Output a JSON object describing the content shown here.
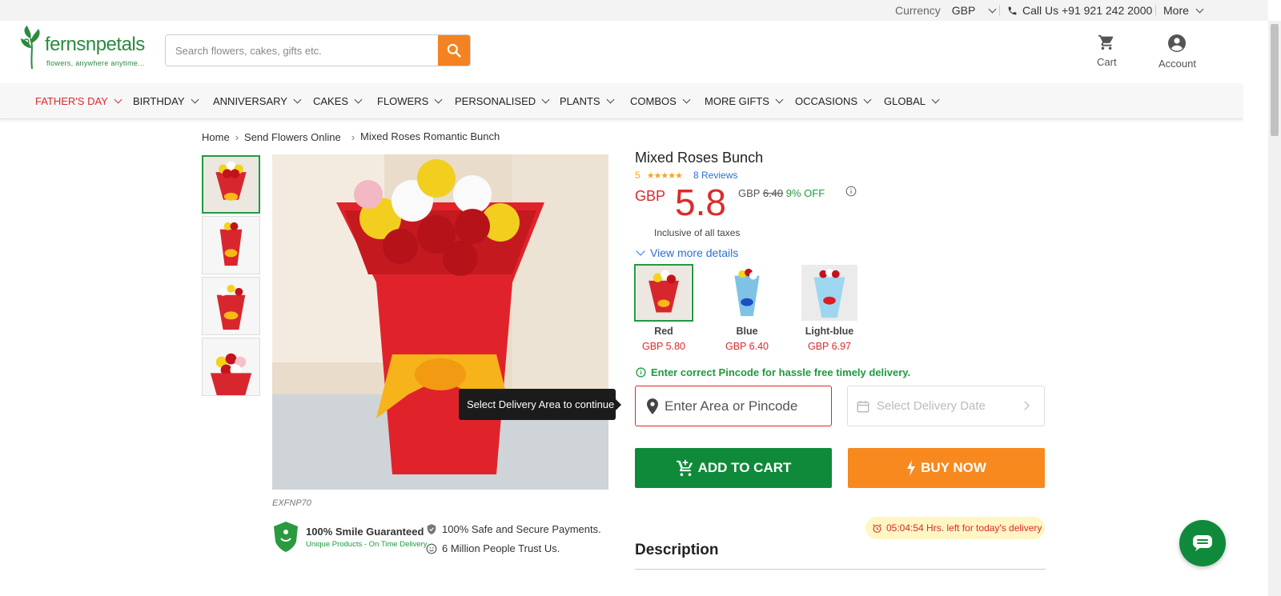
{
  "topbar": {
    "currency_label": "Currency",
    "currency_value": "GBP",
    "call_label": "Call Us +91 921 242 2000",
    "more_label": "More"
  },
  "header": {
    "logo_brand": "fernsnpetals",
    "logo_tagline": "flowers, anywhere anytime...",
    "search_placeholder": "Search flowers, cakes, gifts etc.",
    "cart_label": "Cart",
    "account_label": "Account"
  },
  "nav": {
    "items": [
      "FATHER'S DAY",
      "BIRTHDAY",
      "ANNIVERSARY",
      "CAKES",
      "FLOWERS",
      "PERSONALISED",
      "PLANTS",
      "COMBOS",
      "MORE GIFTS",
      "OCCASIONS",
      "GLOBAL"
    ]
  },
  "breadcrumb": {
    "items": [
      "Home",
      "Send Flowers Online",
      "Mixed Roses Romantic Bunch"
    ]
  },
  "product": {
    "title": "Mixed Roses Bunch",
    "rating": "5",
    "stars": "★★★★★",
    "reviews": "8 Reviews",
    "currency": "GBP",
    "price": "5.8",
    "old_currency": "GBP",
    "old_price": "6.40",
    "discount": "9% OFF",
    "tax_note": "Inclusive of all taxes",
    "view_more": "View more details",
    "sku": "EXFNP70",
    "tooltip": "Select Delivery Area to continue"
  },
  "variants": [
    {
      "name": "Red",
      "price": "GBP  5.80"
    },
    {
      "name": "Blue",
      "price": "GBP  6.40"
    },
    {
      "name": "Light-blue",
      "price": "GBP  6.97"
    }
  ],
  "delivery": {
    "pincode_note": "Enter correct Pincode for hassle free timely delivery.",
    "area_placeholder": "Enter Area or Pincode",
    "date_placeholder": "Select Delivery Date"
  },
  "actions": {
    "add_to_cart": "ADD TO CART",
    "buy_now": "BUY NOW"
  },
  "timer": "05:04:54 Hrs. left for today's delivery",
  "description_heading": "Description",
  "trust": {
    "smile_title": "100% Smile Guaranteed",
    "smile_sub": "Unique Products - On Time Delivery",
    "secure": "100% Safe and Secure Payments.",
    "people": "6 Million People Trust Us."
  },
  "colors": {
    "brand_green": "#0f8a3b",
    "price_red": "#d92b2b",
    "buy_orange": "#f7891f",
    "search_orange": "#f58220",
    "link_blue": "#2a6fd6"
  }
}
